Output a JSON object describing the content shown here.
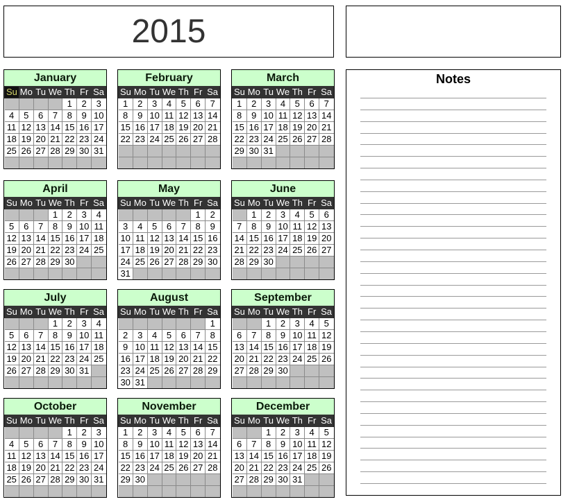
{
  "title": {
    "year": "2015"
  },
  "notes": {
    "title": "Notes",
    "line_count": 34
  },
  "weekdays": [
    "Su",
    "Mo",
    "Tu",
    "We",
    "Th",
    "Fr",
    "Sa"
  ],
  "selected_cell": {
    "month": 0,
    "weekday": 0
  },
  "colors": {
    "month_header": "#ccffcc",
    "weekday_row": "#333333",
    "empty_cell": "#c0c0c0"
  },
  "months": [
    {
      "name": "January",
      "start": 4,
      "days": 31
    },
    {
      "name": "February",
      "start": 0,
      "days": 28
    },
    {
      "name": "March",
      "start": 0,
      "days": 31
    },
    {
      "name": "April",
      "start": 3,
      "days": 30
    },
    {
      "name": "May",
      "start": 5,
      "days": 31
    },
    {
      "name": "June",
      "start": 1,
      "days": 30
    },
    {
      "name": "July",
      "start": 3,
      "days": 31
    },
    {
      "name": "August",
      "start": 6,
      "days": 31
    },
    {
      "name": "September",
      "start": 2,
      "days": 30
    },
    {
      "name": "October",
      "start": 4,
      "days": 31
    },
    {
      "name": "November",
      "start": 0,
      "days": 30
    },
    {
      "name": "December",
      "start": 2,
      "days": 31
    }
  ]
}
